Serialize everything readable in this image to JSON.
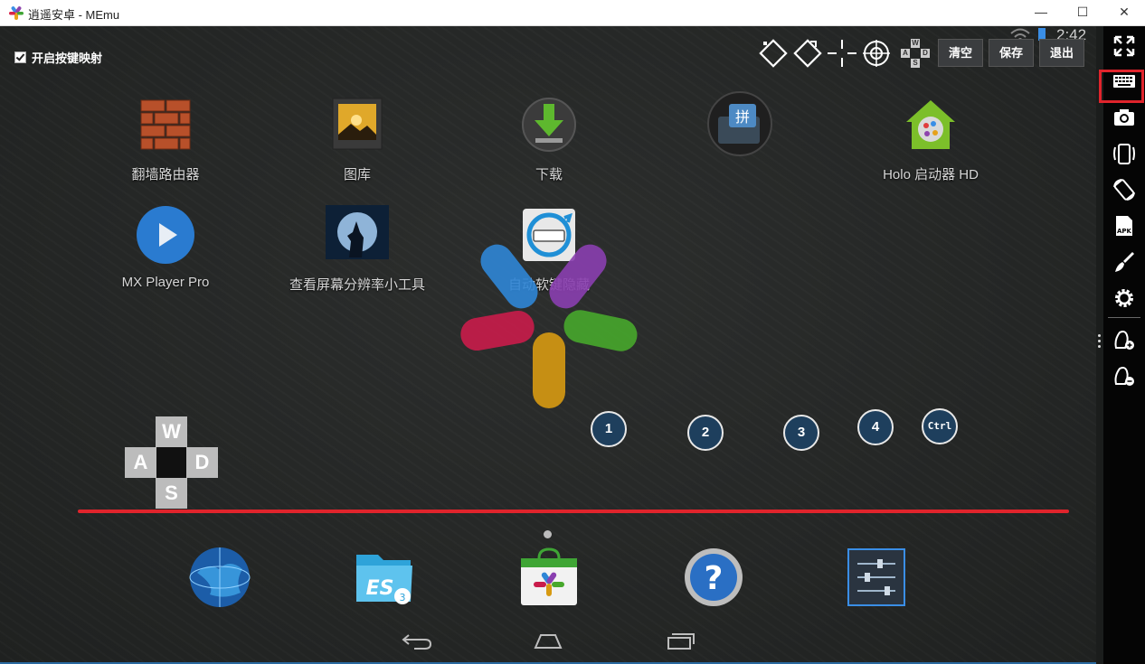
{
  "window": {
    "title": "逍遥安卓 - MEmu",
    "minimize": "—",
    "maximize": "☐",
    "close": "✕"
  },
  "status": {
    "time": "2:42"
  },
  "keymap": {
    "enable_label": "开启按键映射",
    "buttons": {
      "clear": "清空",
      "save": "保存",
      "exit": "退出"
    },
    "wasd": {
      "w": "W",
      "a": "A",
      "s": "S",
      "d": "D"
    },
    "mini_wasd": {
      "w": "W",
      "a": "A",
      "s": "S",
      "d": "D"
    },
    "keys": [
      "1",
      "2",
      "3",
      "4",
      "Ctrl"
    ]
  },
  "apps": [
    {
      "label": "翻墙路由器",
      "icon": "brick-wall-icon"
    },
    {
      "label": "图库",
      "icon": "gallery-icon"
    },
    {
      "label": "下载",
      "icon": "download-icon"
    },
    {
      "label": "",
      "icon": "pinyin-input-icon"
    },
    {
      "label": "Holo 启动器 HD",
      "icon": "holo-launcher-icon"
    },
    {
      "label": "MX Player Pro",
      "icon": "play-icon"
    },
    {
      "label": "查看屏幕分辨率小工具",
      "icon": "moon-wolf-icon"
    },
    {
      "label": "自动软键隐藏",
      "icon": "keyboard-sync-icon"
    }
  ],
  "dock": [
    "globe-browser-icon",
    "es-file-explorer-icon",
    "app-store-icon",
    "help-icon",
    "settings-sliders-icon"
  ],
  "sidebar": [
    "fullscreen-icon",
    "keyboard-icon",
    "camera-icon",
    "shake-icon",
    "rotate-icon",
    "apk-icon",
    "brush-icon",
    "settings-gear-icon",
    "volume-up-icon",
    "volume-down-icon"
  ],
  "colors": {
    "accent_red": "#e0242c",
    "key_ring": "#1e3f5d"
  }
}
